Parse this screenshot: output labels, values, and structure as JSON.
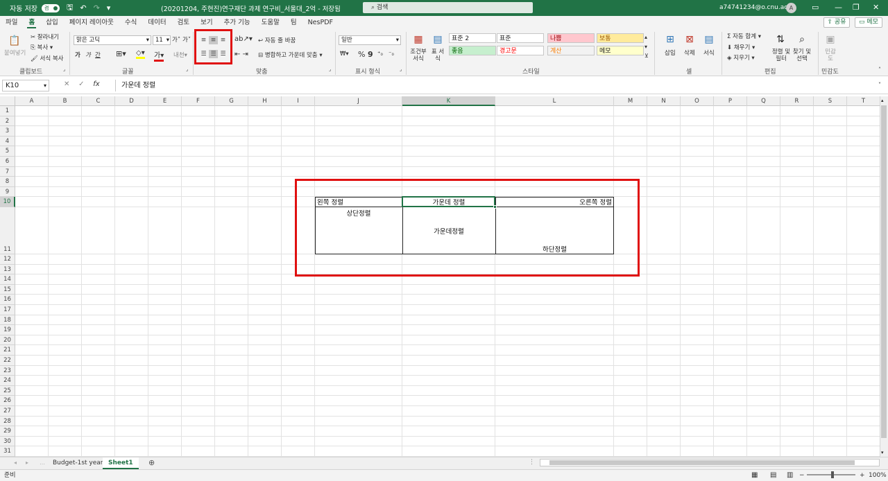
{
  "titlebar": {
    "autosave_label": "자동 저장",
    "autosave_state": "켬",
    "doc_title": "(20201204, 주현진)연구재단 과제 연구비_서울대_2억 - 저장됨",
    "search_placeholder": "검색",
    "user_email": "a74741234@o.cnu.ac.kr",
    "avatar_initial": "A"
  },
  "menu": {
    "tabs": [
      "파일",
      "홈",
      "삽입",
      "페이지 레이아웃",
      "수식",
      "데이터",
      "검토",
      "보기",
      "추가 기능",
      "도움말",
      "팀",
      "NesPDF"
    ],
    "share": "공유",
    "memo": "메모"
  },
  "ribbon": {
    "clipboard": {
      "paste": "붙여넣기",
      "cut": "잘라내기",
      "copy": "복사",
      "format_painter": "서식 복사",
      "label": "클립보드"
    },
    "font": {
      "name": "맑은 고딕",
      "size": "11",
      "label": "글꼴",
      "bold": "가",
      "italic": "가",
      "underline": "간"
    },
    "alignment": {
      "wrap": "자동 줄 바꿈",
      "merge": "병합하고 가운데 맞춤",
      "label": "맞춤"
    },
    "number": {
      "format": "일반",
      "percent": "%",
      "comma": "9",
      "label": "표시 형식"
    },
    "styles": {
      "conditional": "조건부 서식",
      "table": "표 서식",
      "label": "스타일",
      "cells": [
        {
          "name": "표준 2",
          "bg": "#ffffff",
          "fg": "#222222"
        },
        {
          "name": "표준",
          "bg": "#ffffff",
          "fg": "#222222"
        },
        {
          "name": "나쁨",
          "bg": "#ffc7ce",
          "fg": "#9c0006"
        },
        {
          "name": "보통",
          "bg": "#ffeb9c",
          "fg": "#9c5700"
        },
        {
          "name": "좋음",
          "bg": "#c6efce",
          "fg": "#006100"
        },
        {
          "name": "경고문",
          "bg": "#ffffff",
          "fg": "#ff0000"
        },
        {
          "name": "계산",
          "bg": "#f2f2f2",
          "fg": "#fa7d00"
        },
        {
          "name": "메모",
          "bg": "#ffffcc",
          "fg": "#222222"
        }
      ]
    },
    "cells": {
      "insert": "삽입",
      "delete": "삭제",
      "format": "서식",
      "label": "셀"
    },
    "editing": {
      "autosum": "자동 합계",
      "fill": "채우기",
      "clear": "지우기",
      "sort": "정렬 및 필터",
      "find": "찾기 및 선택",
      "label": "편집"
    },
    "sensitivity": {
      "btn": "민감도",
      "label": "민감도"
    }
  },
  "formula": {
    "namebox": "K10",
    "value": "가운데 정렬"
  },
  "columns": [
    "A",
    "B",
    "C",
    "D",
    "E",
    "F",
    "G",
    "H",
    "I",
    "J",
    "K",
    "L",
    "M",
    "N",
    "O",
    "P",
    "Q",
    "R",
    "S",
    "T"
  ],
  "rows": [
    "1",
    "2",
    "3",
    "4",
    "5",
    "6",
    "7",
    "8",
    "9",
    "10",
    "11",
    "12",
    "13",
    "14",
    "15",
    "16",
    "17",
    "18",
    "19",
    "20",
    "21",
    "22",
    "23",
    "24",
    "25",
    "26",
    "27",
    "28",
    "29",
    "30",
    "31"
  ],
  "cells": {
    "J10": "왼쪽 정렬",
    "K10": "가운데 정렬",
    "L10": "오른쪽 정렬",
    "J11": "상단정렬",
    "K11": "가운데정렬",
    "L11": "하단정렬"
  },
  "sheets": [
    "Budget-1st year",
    "Sheet1"
  ],
  "status": {
    "ready": "준비",
    "zoom": "100%"
  },
  "colors": {
    "accent": "#217346",
    "highlight": "#e01010"
  }
}
